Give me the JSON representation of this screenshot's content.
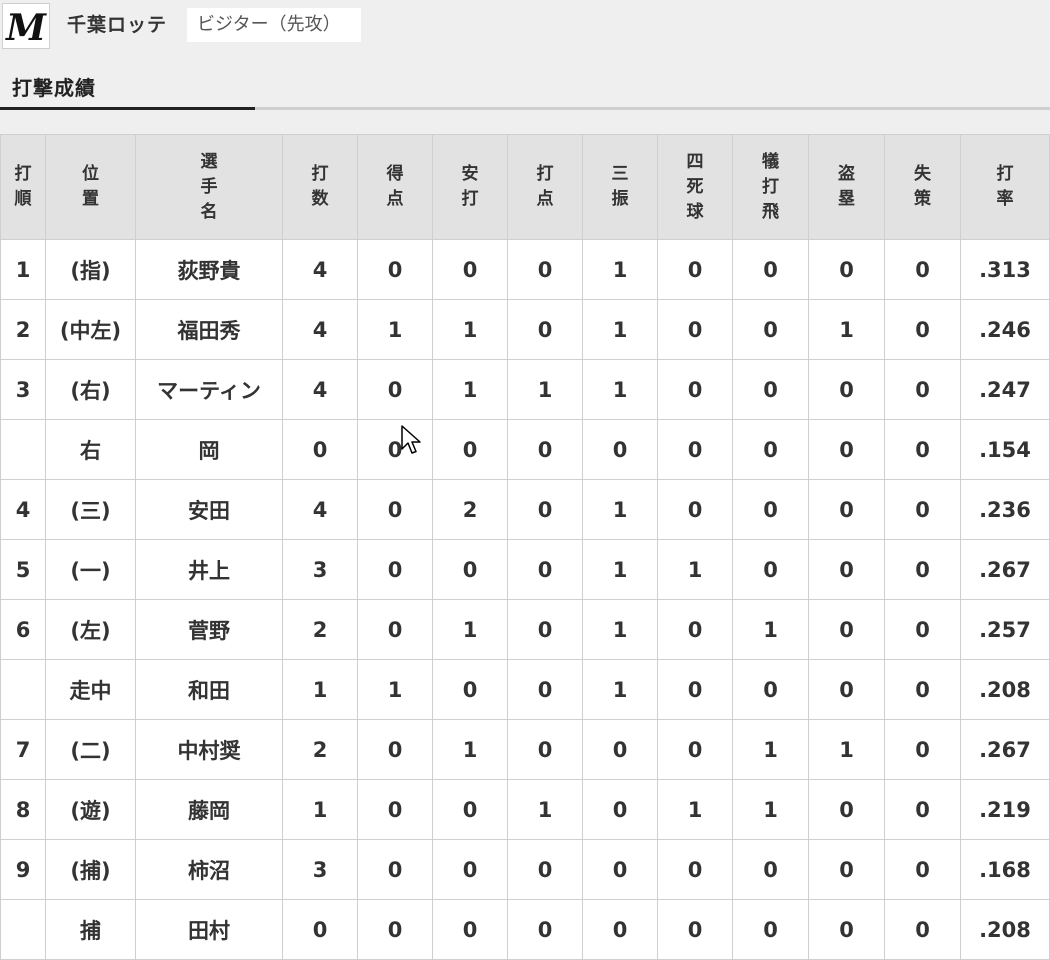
{
  "header": {
    "team_name": "千葉ロッテ",
    "side_label": "ビジター（先攻）",
    "logo_letter": "M"
  },
  "section_title": "打撃成績",
  "columns": {
    "order": "打順",
    "pos": "位置",
    "name": "選手名",
    "ab": "打数",
    "r": "得点",
    "h": "安打",
    "rbi": "打点",
    "so": "三振",
    "bb": "四死球",
    "sac": "犠打飛",
    "sb": "盗塁",
    "e": "失策",
    "avg": "打率"
  },
  "rows": [
    {
      "order": "1",
      "pos": "(指)",
      "name": "荻野貴",
      "ab": "4",
      "r": "0",
      "h": "0",
      "rbi": "0",
      "so": "1",
      "bb": "0",
      "sac": "0",
      "sb": "0",
      "e": "0",
      "avg": ".313"
    },
    {
      "order": "2",
      "pos": "(中左)",
      "name": "福田秀",
      "ab": "4",
      "r": "1",
      "h": "1",
      "rbi": "0",
      "so": "1",
      "bb": "0",
      "sac": "0",
      "sb": "1",
      "e": "0",
      "avg": ".246"
    },
    {
      "order": "3",
      "pos": "(右)",
      "name": "マーティン",
      "ab": "4",
      "r": "0",
      "h": "1",
      "rbi": "1",
      "so": "1",
      "bb": "0",
      "sac": "0",
      "sb": "0",
      "e": "0",
      "avg": ".247"
    },
    {
      "order": "",
      "pos": "右",
      "name": "岡",
      "ab": "0",
      "r": "0",
      "h": "0",
      "rbi": "0",
      "so": "0",
      "bb": "0",
      "sac": "0",
      "sb": "0",
      "e": "0",
      "avg": ".154"
    },
    {
      "order": "4",
      "pos": "(三)",
      "name": "安田",
      "ab": "4",
      "r": "0",
      "h": "2",
      "rbi": "0",
      "so": "1",
      "bb": "0",
      "sac": "0",
      "sb": "0",
      "e": "0",
      "avg": ".236"
    },
    {
      "order": "5",
      "pos": "(一)",
      "name": "井上",
      "ab": "3",
      "r": "0",
      "h": "0",
      "rbi": "0",
      "so": "1",
      "bb": "1",
      "sac": "0",
      "sb": "0",
      "e": "0",
      "avg": ".267"
    },
    {
      "order": "6",
      "pos": "(左)",
      "name": "菅野",
      "ab": "2",
      "r": "0",
      "h": "1",
      "rbi": "0",
      "so": "1",
      "bb": "0",
      "sac": "1",
      "sb": "0",
      "e": "0",
      "avg": ".257"
    },
    {
      "order": "",
      "pos": "走中",
      "name": "和田",
      "ab": "1",
      "r": "1",
      "h": "0",
      "rbi": "0",
      "so": "1",
      "bb": "0",
      "sac": "0",
      "sb": "0",
      "e": "0",
      "avg": ".208"
    },
    {
      "order": "7",
      "pos": "(二)",
      "name": "中村奨",
      "ab": "2",
      "r": "0",
      "h": "1",
      "rbi": "0",
      "so": "0",
      "bb": "0",
      "sac": "1",
      "sb": "1",
      "e": "0",
      "avg": ".267"
    },
    {
      "order": "8",
      "pos": "(遊)",
      "name": "藤岡",
      "ab": "1",
      "r": "0",
      "h": "0",
      "rbi": "1",
      "so": "0",
      "bb": "1",
      "sac": "1",
      "sb": "0",
      "e": "0",
      "avg": ".219"
    },
    {
      "order": "9",
      "pos": "(捕)",
      "name": "柿沼",
      "ab": "3",
      "r": "0",
      "h": "0",
      "rbi": "0",
      "so": "0",
      "bb": "0",
      "sac": "0",
      "sb": "0",
      "e": "0",
      "avg": ".168"
    },
    {
      "order": "",
      "pos": "捕",
      "name": "田村",
      "ab": "0",
      "r": "0",
      "h": "0",
      "rbi": "0",
      "so": "0",
      "bb": "0",
      "sac": "0",
      "sb": "0",
      "e": "0",
      "avg": ".208"
    }
  ],
  "colors": {
    "name_link": "#1f3a7a",
    "header_bg": "#e2e2e2",
    "page_bg": "#efefef"
  },
  "icons": {
    "logo": "marines-logo-icon",
    "cursor": "mouse-cursor-icon"
  }
}
